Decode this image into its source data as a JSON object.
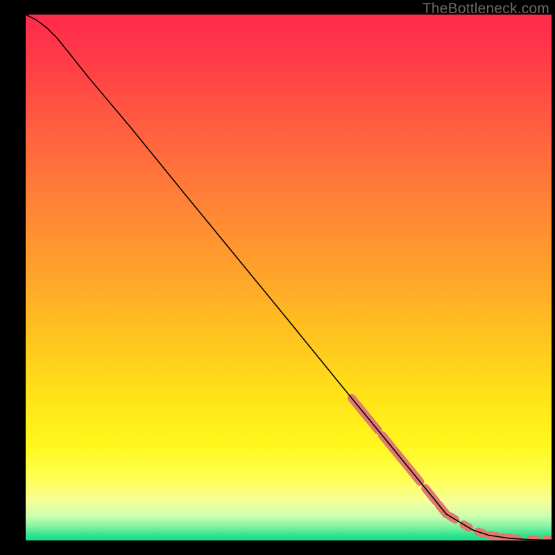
{
  "watermark": "TheBottleneck.com",
  "chart_data": {
    "type": "line",
    "title": "",
    "xlabel": "",
    "ylabel": "",
    "xlim": [
      0,
      100
    ],
    "ylim": [
      0,
      100
    ],
    "grid": false,
    "series": [
      {
        "name": "curve",
        "stroke": "#000000",
        "x": [
          0,
          2,
          4,
          6,
          8,
          12,
          20,
          30,
          40,
          50,
          60,
          70,
          80,
          85,
          88,
          92,
          95,
          98,
          100
        ],
        "y": [
          100,
          99,
          97.5,
          95.5,
          93,
          88,
          78.5,
          66.2,
          54,
          41.8,
          29.5,
          17.3,
          5.0,
          2.0,
          1.0,
          0.4,
          0.2,
          0.1,
          0.1
        ]
      }
    ],
    "highlight_segments": {
      "name": "highlight",
      "color": "#e07a6f",
      "radius_px": 6,
      "segments": [
        {
          "x0": 62,
          "x1": 67
        },
        {
          "x0": 67.8,
          "x1": 75
        },
        {
          "x0": 76,
          "x1": 78
        },
        {
          "x0": 78.5,
          "x1": 80
        },
        {
          "x0": 80.7,
          "x1": 81.7
        },
        {
          "x0": 83.3,
          "x1": 84.3
        },
        {
          "x0": 86.0,
          "x1": 87.0
        },
        {
          "x0": 88.2,
          "x1": 89.6
        },
        {
          "x0": 90.8,
          "x1": 93.8
        },
        {
          "x0": 96.0,
          "x1": 97.2
        },
        {
          "x0": 99.0,
          "x1": 100.0
        }
      ]
    },
    "background_gradient": {
      "stops": [
        {
          "offset": 0.0,
          "color": "#ff2a4c"
        },
        {
          "offset": 0.1,
          "color": "#ff3f47"
        },
        {
          "offset": 0.22,
          "color": "#ff6040"
        },
        {
          "offset": 0.35,
          "color": "#ff8037"
        },
        {
          "offset": 0.5,
          "color": "#ffa52a"
        },
        {
          "offset": 0.62,
          "color": "#ffc61e"
        },
        {
          "offset": 0.73,
          "color": "#ffe418"
        },
        {
          "offset": 0.82,
          "color": "#fff81e"
        },
        {
          "offset": 0.885,
          "color": "#ffff55"
        },
        {
          "offset": 0.925,
          "color": "#f6ff9a"
        },
        {
          "offset": 0.955,
          "color": "#c8ffb0"
        },
        {
          "offset": 0.975,
          "color": "#7df2a0"
        },
        {
          "offset": 0.99,
          "color": "#2fe48f"
        },
        {
          "offset": 1.0,
          "color": "#1ddc88"
        }
      ]
    }
  }
}
